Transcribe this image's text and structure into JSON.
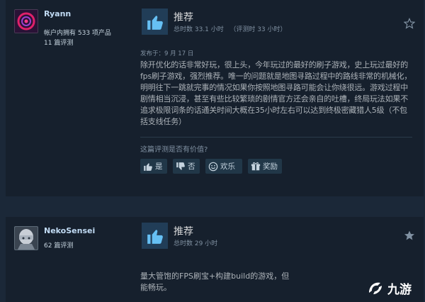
{
  "reviews": [
    {
      "author": "Ryann",
      "products_line": "帐户内拥有 533 项产品",
      "reviews_line": "11 篇评测",
      "verdict": "推荐",
      "hours": "总时数 33.1 小时   （评测时 33 小时）",
      "posted": "发布于：9 月 17 日",
      "body": "除开优化的话非常好玩，很上头，今年玩过的最好的刷子游戏，史上玩过最好的fps刷子游戏，强烈推荐。唯一的问题就是地图寻路过程中的路线非常的机械化，明明往下一跳就完事的情况如果你按照地图寻路可能会让你绕很远。游戏过程中剧情相当沉浸，甚至有些比较繁琐的剧情官方还会亲自的吐槽，终局玩法如果不追求极限词条的话通关时间大概在35小时左右可以达到终极密藏猎人5级（不包括支线任务）",
      "helpful_question": "这篇评测是否有价值?",
      "buttons": {
        "yes": "是",
        "no": "否",
        "funny": "欢乐",
        "award": "奖励"
      }
    },
    {
      "author": "NekoSensei",
      "reviews_line": "62 篇评测",
      "verdict": "推荐",
      "hours": "总时数 29 小时",
      "body": "量大管饱的FPS刷宝+构建build的游戏，但",
      "body_line2": "能畅玩。"
    }
  ],
  "watermark": {
    "text": "九游"
  },
  "icons": {
    "thumb": "thumbs-up-icon",
    "flag": "star-flag-icon"
  },
  "colors": {
    "background": "#1b2838",
    "panel": "#16202d",
    "accent": "#66c0f4",
    "thumb_box": "#213d57"
  }
}
